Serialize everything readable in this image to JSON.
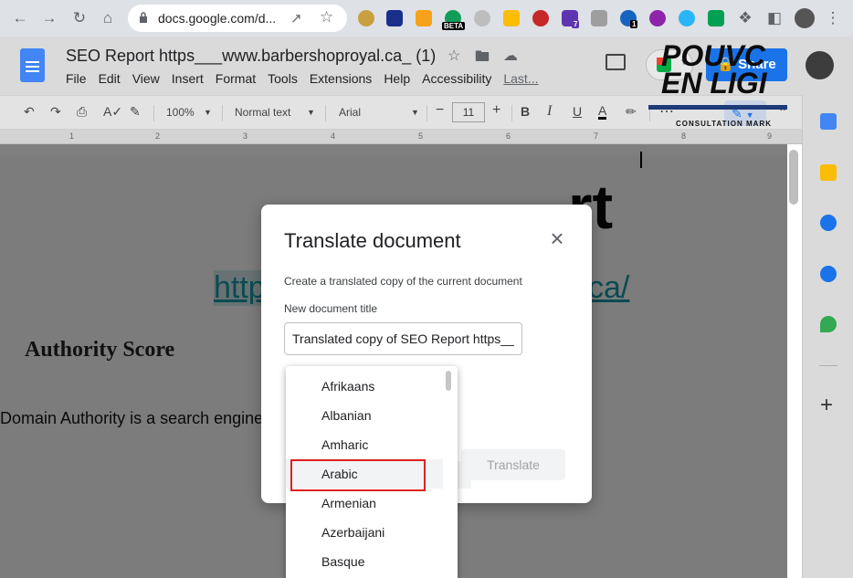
{
  "browser": {
    "url": "docs.google.com/d...",
    "extension_badges": {
      "beta": "BETA",
      "purple": "7",
      "chain": "1"
    }
  },
  "docs": {
    "title": "SEO Report https___www.barbershoproyal.ca_ (1)",
    "menu": [
      "File",
      "Edit",
      "View",
      "Insert",
      "Format",
      "Tools",
      "Extensions",
      "Help",
      "Accessibility"
    ],
    "last_edit": "Last...",
    "share_label": "Share"
  },
  "toolbar": {
    "zoom": "100%",
    "style": "Normal text",
    "font": "Arial",
    "font_size": "11",
    "bold": "B",
    "italic": "I",
    "underline": "U",
    "text_color": "A",
    "more": "⋯"
  },
  "ruler": {
    "marks": [
      "1",
      "2",
      "3",
      "4",
      "5",
      "6",
      "7",
      "8",
      "9"
    ]
  },
  "document": {
    "logo_line1": "POUVC",
    "logo_line2": "EN LIGI",
    "logo_sub": "CONSULTATION MARK",
    "big_title_fragment": "rt",
    "url_left": "http",
    "url_right": "ca/",
    "heading": "Authority Score",
    "paragraph": "Domain Authority is a search engine                                    gives a measure of how successful a"
  },
  "dialog": {
    "title": "Translate document",
    "description": "Create a translated copy of the current document",
    "new_title_label": "New document title",
    "new_title_value": "Translated copy of SEO Report https___",
    "translate_button": "Translate"
  },
  "languages": {
    "items": [
      "Afrikaans",
      "Albanian",
      "Amharic",
      "Arabic",
      "Armenian",
      "Azerbaijani",
      "Basque"
    ],
    "highlighted": "Arabic"
  },
  "colors": {
    "chrome_bg": "#dee1e6",
    "share_blue": "#1a73e8",
    "highlight_red": "#e02020",
    "link_teal": "#0b4b53"
  }
}
